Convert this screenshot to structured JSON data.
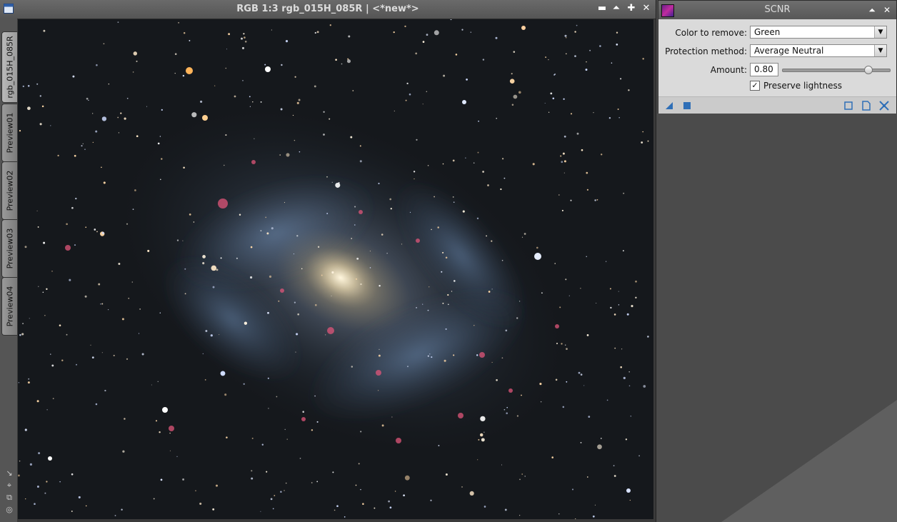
{
  "image_window": {
    "title": "RGB 1:3 rgb_015H_085R | <*new*>",
    "controls": {
      "minimize": "▬",
      "shade": "⏶",
      "maximize": "✚",
      "close": "✕"
    },
    "tabs": [
      {
        "label": "rgb_015H_085R",
        "active": true
      },
      {
        "label": "Preview01",
        "active": false
      },
      {
        "label": "Preview02",
        "active": false
      },
      {
        "label": "Preview03",
        "active": false
      },
      {
        "label": "Preview04",
        "active": false
      }
    ],
    "side_tools": [
      "↘",
      "⌖",
      "⧉",
      "◎"
    ]
  },
  "scnr_panel": {
    "title": "SCNR",
    "controls": {
      "shade": "⏶",
      "close": "✕"
    },
    "color_to_remove": {
      "label": "Color to remove:",
      "value": "Green"
    },
    "protection_method": {
      "label": "Protection method:",
      "value": "Average Neutral"
    },
    "amount": {
      "label": "Amount:",
      "value": "0.80",
      "fraction": 0.8
    },
    "preserve_lightness": {
      "label": "Preserve lightness",
      "checked": true,
      "mark": "✓"
    },
    "colors": {
      "accent": "#2f6fb7",
      "panel_bg": "#dadada"
    }
  }
}
